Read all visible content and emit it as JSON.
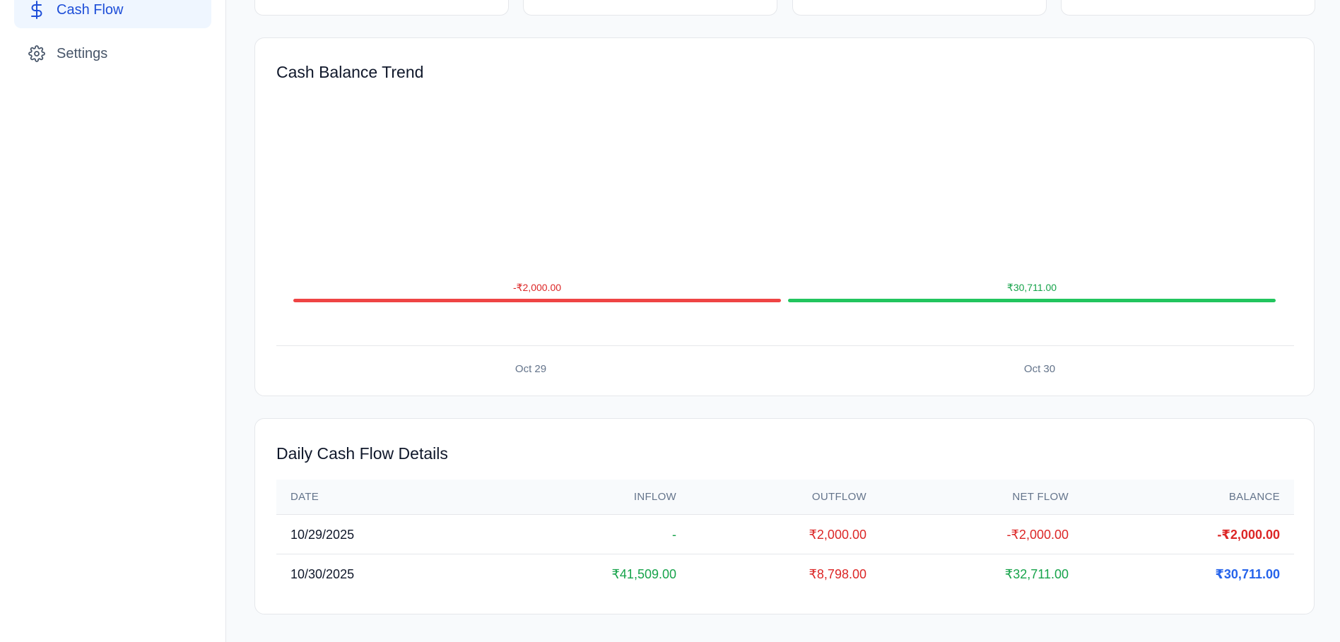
{
  "sidebar": {
    "items": [
      {
        "label": "Cash Flow",
        "icon": "dollar-icon",
        "active": true
      },
      {
        "label": "Settings",
        "icon": "gear-icon",
        "active": false
      }
    ]
  },
  "chart_card": {
    "title": "Cash Balance Trend"
  },
  "chart_data": {
    "type": "bar",
    "title": "Cash Balance Trend",
    "categories": [
      "Oct 29",
      "Oct 30"
    ],
    "values": [
      -2000,
      30711
    ],
    "value_labels": [
      "-₹2,000.00",
      "₹30,711.00"
    ],
    "colors": [
      "#ef4444",
      "#22c55e"
    ],
    "xlabel": "",
    "ylabel": ""
  },
  "table_card": {
    "title": "Daily Cash Flow Details",
    "headers": [
      "DATE",
      "INFLOW",
      "OUTFLOW",
      "NET FLOW",
      "BALANCE"
    ],
    "rows": [
      {
        "date": "10/29/2025",
        "inflow": "-",
        "outflow": "₹2,000.00",
        "net": "-₹2,000.00",
        "balance": "-₹2,000.00"
      },
      {
        "date": "10/30/2025",
        "inflow": "₹41,509.00",
        "outflow": "₹8,798.00",
        "net": "₹32,711.00",
        "balance": "₹30,711.00"
      }
    ]
  },
  "colors": {
    "accent": "#1d4ed8",
    "positive": "#16a34a",
    "negative": "#dc2626",
    "balance_positive": "#2563eb"
  }
}
